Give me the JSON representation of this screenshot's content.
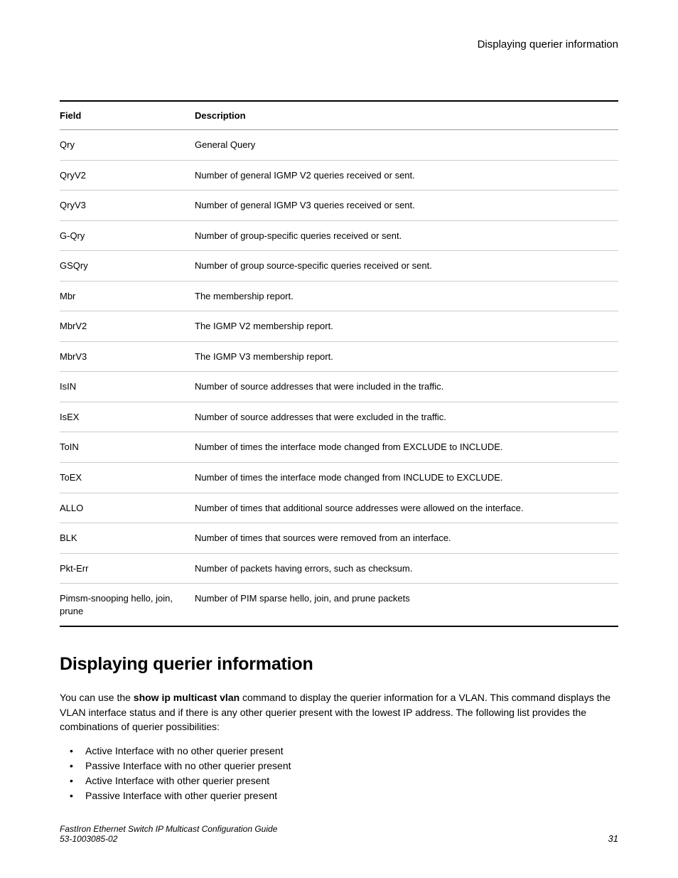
{
  "header": {
    "running_title": "Displaying querier information"
  },
  "table": {
    "head": {
      "field": "Field",
      "desc": "Description"
    },
    "rows": [
      {
        "field": "Qry",
        "desc": "General Query"
      },
      {
        "field": "QryV2",
        "desc": "Number of general IGMP V2 queries received or sent."
      },
      {
        "field": "QryV3",
        "desc": "Number of general IGMP V3 queries received or sent."
      },
      {
        "field": "G-Qry",
        "desc": "Number of group-specific queries received or sent."
      },
      {
        "field": "GSQry",
        "desc": "Number of group source-specific queries received or sent."
      },
      {
        "field": "Mbr",
        "desc": "The membership report."
      },
      {
        "field": "MbrV2",
        "desc": "The IGMP V2 membership report."
      },
      {
        "field": "MbrV3",
        "desc": "The IGMP V3 membership report."
      },
      {
        "field": "IsIN",
        "desc": "Number of source addresses that were included in the traffic."
      },
      {
        "field": "IsEX",
        "desc": "Number of source addresses that were excluded in the traffic."
      },
      {
        "field": "ToIN",
        "desc": "Number of times the interface mode changed from EXCLUDE to INCLUDE."
      },
      {
        "field": "ToEX",
        "desc": "Number of times the interface mode changed from INCLUDE to EXCLUDE."
      },
      {
        "field": "ALLO",
        "desc": "Number of times that additional source addresses were allowed on the interface."
      },
      {
        "field": "BLK",
        "desc": "Number of times that sources were removed from an interface."
      },
      {
        "field": "Pkt-Err",
        "desc": "Number of packets having errors, such as checksum."
      },
      {
        "field": "Pimsm-snooping hello, join, prune",
        "desc": "Number of PIM sparse hello, join, and prune packets"
      }
    ]
  },
  "section": {
    "title": "Displaying querier information",
    "para_pre": "You can use the ",
    "para_cmd": "show ip multicast vlan",
    "para_post": " command to display the querier information for a VLAN. This command displays the VLAN interface status and if there is any other querier present with the lowest IP address. The following list provides the combinations of querier possibilities:",
    "bullets": [
      "Active Interface with no other querier present",
      "Passive Interface with no other querier present",
      "Active Interface with other querier present",
      "Passive Interface with other querier present"
    ]
  },
  "footer": {
    "doc_title": "FastIron Ethernet Switch IP Multicast Configuration Guide",
    "doc_num": "53-1003085-02",
    "page_num": "31"
  }
}
